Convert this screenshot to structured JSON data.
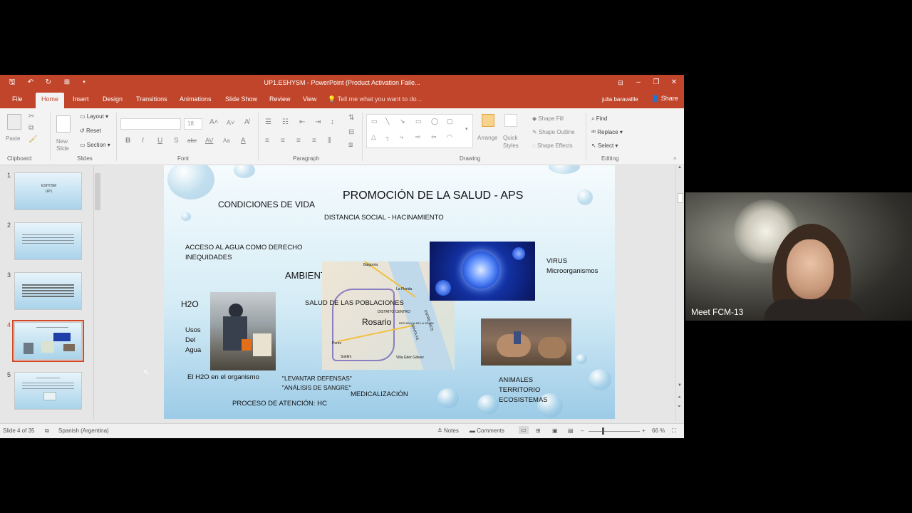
{
  "window": {
    "title": "UP1.ESHYSM - PowerPoint (Product Activation Faile...",
    "qat": [
      "save-icon",
      "undo-icon",
      "redo-icon",
      "start-from-beginning-icon"
    ]
  },
  "tabs": [
    {
      "label": "File",
      "active": false
    },
    {
      "label": "Home",
      "active": true
    },
    {
      "label": "Insert",
      "active": false
    },
    {
      "label": "Design",
      "active": false
    },
    {
      "label": "Transitions",
      "active": false
    },
    {
      "label": "Animations",
      "active": false
    },
    {
      "label": "Slide Show",
      "active": false
    },
    {
      "label": "Review",
      "active": false
    },
    {
      "label": "View",
      "active": false
    }
  ],
  "tell_me": "Tell me what you want to do...",
  "user": "julia baravallle",
  "share": "Share",
  "ribbon": {
    "paste": "Paste",
    "new_slide": "New Slide",
    "layout": "Layout",
    "reset": "Reset",
    "section": "Section",
    "font_size": "18",
    "arrange": "Arrange",
    "quick_styles": "Quick Styles",
    "shape_fill": "Shape Fill",
    "shape_outline": "Shape Outline",
    "shape_effects": "Shape Effects",
    "find": "Find",
    "replace": "Replace",
    "select": "Select",
    "groups": {
      "clipboard": "Clipboard",
      "slides": "Slides",
      "font": "Font",
      "paragraph": "Paragraph",
      "drawing": "Drawing",
      "editing": "Editing"
    },
    "font_buttons": [
      "B",
      "I",
      "U",
      "S",
      "abc",
      "AV",
      "Aa"
    ]
  },
  "thumbnails": [
    {
      "num": "1",
      "selected": false
    },
    {
      "num": "2",
      "selected": false
    },
    {
      "num": "3",
      "selected": false
    },
    {
      "num": "4",
      "selected": true
    },
    {
      "num": "5",
      "selected": false
    }
  ],
  "slide": {
    "title": "PROMOCIÓN DE LA SALUD - APS",
    "condiciones": "CONDICIONES DE VIDA",
    "distancia": "DISTANCIA SOCIAL - HACINAMIENTO",
    "acceso": "ACCESO AL AGUA COMO DERECHO",
    "inequidades": "INEQUIDADES",
    "ambiente": "AMBIENTE",
    "h2o": "H2O",
    "usos": "Usos",
    "del": "Del",
    "agua": "Agua",
    "salud_poblaciones": "SALUD DE LAS POBLACIONES",
    "rosario": "Rosario",
    "virus": "VIRUS",
    "microorganismos": "Microorganismos",
    "h2o_organismo": "El H2O en el organismo",
    "levantar": "\"LEVANTAR DEFENSAS\"",
    "analisis": "\"ANÁLISIS DE SANGRE\"",
    "medicalizacion": "MEDICALIZACIÓN",
    "proceso": "PROCESO DE ATENCIÓN: HC",
    "animales": "ANIMALES",
    "territorio": "TERRITORIO",
    "ecosistemas": "ECOSISTEMAS",
    "map_labels": {
      "baigorria": "Baigorria",
      "la_florida": "La Florida",
      "distrito_centro": "DISTRITO CENTRO",
      "republica": "REPUBLICA DE LA SEXTA",
      "santa_fe": "SANTA FE",
      "entre_rios": "ENTRE RÍOS",
      "perez": "Perez",
      "soldini": "Soldini",
      "villa_gdor": "Villa Gdor Gálvez"
    },
    "thumb1_title": "ESHYSM\nUP1"
  },
  "status": {
    "slide_info": "Slide 4 of 35",
    "language": "Spanish (Argentina)",
    "notes": "Notes",
    "comments": "Comments",
    "zoom": "66 %"
  },
  "meet": {
    "label": "Meet FCM-13"
  },
  "colors": {
    "ppt_accent": "#c1452a",
    "selected_thumb_border": "#d24726"
  }
}
